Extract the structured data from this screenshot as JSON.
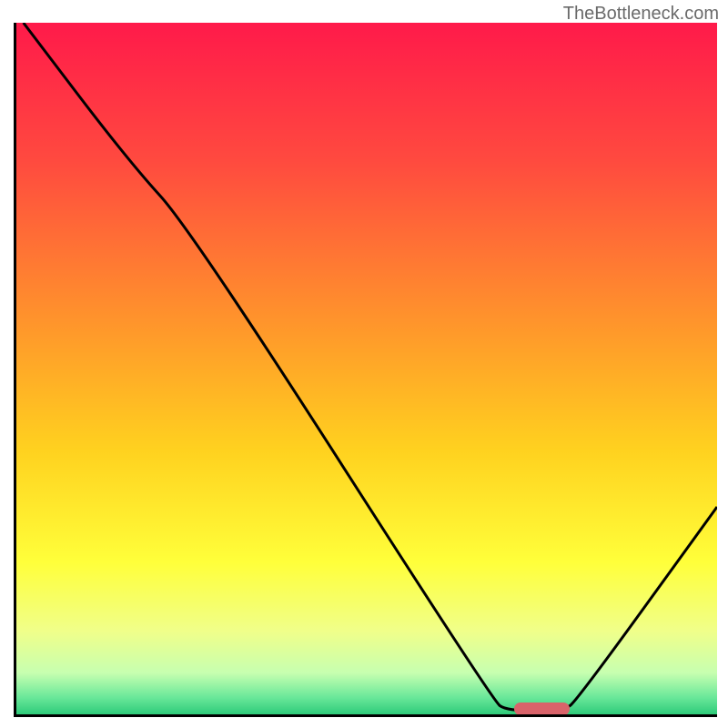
{
  "watermark": "TheBottleneck.com",
  "chart_data": {
    "type": "line",
    "title": "",
    "xlabel": "",
    "ylabel": "",
    "xlim": [
      0,
      100
    ],
    "ylim": [
      0,
      100
    ],
    "gradient_stops": [
      {
        "pos": 0,
        "color": "#ff1a4a"
      },
      {
        "pos": 20,
        "color": "#ff4a3f"
      },
      {
        "pos": 45,
        "color": "#ff9a2a"
      },
      {
        "pos": 62,
        "color": "#ffd21f"
      },
      {
        "pos": 78,
        "color": "#ffff3a"
      },
      {
        "pos": 88,
        "color": "#f0ff8a"
      },
      {
        "pos": 94,
        "color": "#c7ffb0"
      },
      {
        "pos": 97.5,
        "color": "#6be89a"
      },
      {
        "pos": 100,
        "color": "#2ecb7a"
      }
    ],
    "series": [
      {
        "name": "bottleneck-curve",
        "points": [
          {
            "x": 1,
            "y": 100
          },
          {
            "x": 16,
            "y": 80
          },
          {
            "x": 25,
            "y": 70
          },
          {
            "x": 68,
            "y": 2
          },
          {
            "x": 70,
            "y": 0.5
          },
          {
            "x": 78,
            "y": 0.5
          },
          {
            "x": 80,
            "y": 2
          },
          {
            "x": 100,
            "y": 30
          }
        ]
      }
    ],
    "marker": {
      "x_start": 71,
      "x_end": 79,
      "y": 0.5
    }
  }
}
